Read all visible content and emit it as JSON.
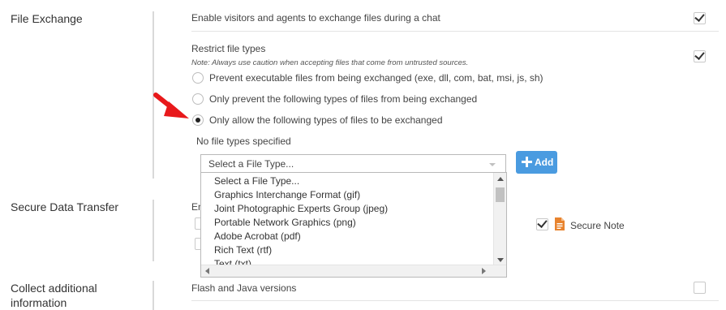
{
  "sections": {
    "file_exchange": "File Exchange",
    "secure_data_transfer": "Secure Data Transfer",
    "collect_additional": [
      "Collect additional",
      "information"
    ]
  },
  "file_exchange": {
    "enable_label": "Enable visitors and agents to exchange files during a chat",
    "enable_checked": true,
    "restrict_label": "Restrict file types",
    "restrict_note": "Note: Always use caution when accepting files that come from untrusted sources.",
    "restrict_checked": true,
    "radio_options": [
      {
        "label": "Prevent executable files from being exchanged (exe, dll, com, bat, msi, js, sh)",
        "selected": false
      },
      {
        "label": "Only prevent the following types of files from being exchanged",
        "selected": false
      },
      {
        "label": "Only allow the following types of files to be exchanged",
        "selected": true
      }
    ],
    "no_file_types": "No file types specified",
    "select_value": "Select a File Type...",
    "add_button": "Add",
    "file_type_options": [
      "Select a File Type...",
      "Graphics Interchange Format (gif)",
      "Joint Photographic Experts Group (jpeg)",
      "Portable Network Graphics (png)",
      "Adobe Acrobat (pdf)",
      "Rich Text (rtf)",
      "Text (txt)"
    ]
  },
  "secure_data": {
    "partial_label": "En",
    "secure_note_label": "Secure Note",
    "secure_note_checked": true
  },
  "collect": {
    "flash_java_label": "Flash and Java versions",
    "flash_java_checked": false
  },
  "colors": {
    "arrow": "#e8191b",
    "add_button": "#4a9be0",
    "note_icon": "#e8832e"
  }
}
